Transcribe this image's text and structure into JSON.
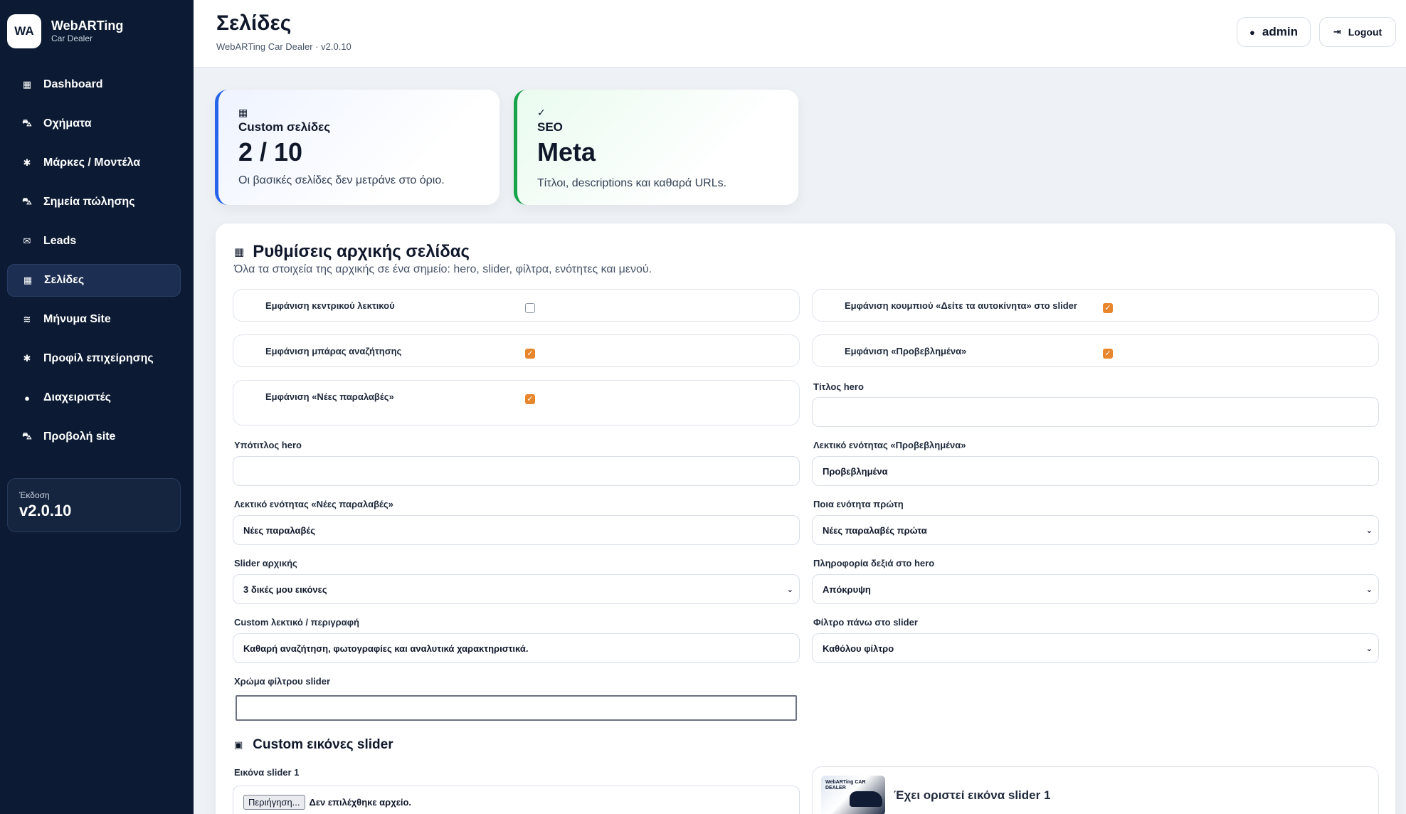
{
  "brand": {
    "logo": "WA",
    "name": "WebARTing",
    "sub": "Car Dealer"
  },
  "sidebar": {
    "items": [
      {
        "label": "Dashboard",
        "icon": "grid-icon"
      },
      {
        "label": "Οχήματα",
        "icon": "car-icon"
      },
      {
        "label": "Μάρκες / Μοντέλα",
        "icon": "gear-icon"
      },
      {
        "label": "Σημεία πώλησης",
        "icon": "car-icon"
      },
      {
        "label": "Leads",
        "icon": "mail-icon"
      },
      {
        "label": "Σελίδες",
        "icon": "grid-icon",
        "active": true
      },
      {
        "label": "Μήνυμα Site",
        "icon": "layers-icon"
      },
      {
        "label": "Προφίλ επιχείρησης",
        "icon": "gear-icon"
      },
      {
        "label": "Διαχειριστές",
        "icon": "user-icon"
      },
      {
        "label": "Προβολή site",
        "icon": "car-icon"
      }
    ],
    "version_label": "Έκδοση",
    "version_value": "v2.0.10"
  },
  "header": {
    "title": "Σελίδες",
    "subtitle": "WebARTing Car Dealer · v2.0.10",
    "user_label": "admin",
    "logout_label": "Logout"
  },
  "stats": {
    "custom": {
      "label": "Custom σελίδες",
      "value": "2 / 10",
      "desc": "Οι βασικές σελίδες δεν μετράνε στο όριο."
    },
    "seo": {
      "label": "SEO",
      "value": "Meta",
      "desc": "Τίτλοι, descriptions και καθαρά URLs."
    }
  },
  "panel": {
    "title": "Ρυθμίσεις αρχικής σελίδας",
    "subtitle": "Όλα τα στοιχεία της αρχικής σε ένα σημείο: hero, slider, φίλτρα, ενότητες και μενού.",
    "toggles": {
      "show_center_text": {
        "label": "Εμφάνιση κεντρικού λεκτικού",
        "checked": false
      },
      "show_button": {
        "label": "Εμφάνιση κουμπιού «Δείτε τα αυτοκίνητα» στο slider",
        "checked": true
      },
      "show_search": {
        "label": "Εμφάνιση μπάρας αναζήτησης",
        "checked": true
      },
      "show_featured": {
        "label": "Εμφάνιση «Προβεβλημένα»",
        "checked": true
      },
      "show_new": {
        "label": "Εμφάνιση «Νέες παραλαβές»",
        "checked": true
      }
    },
    "fields": {
      "hero_title": {
        "label": "Τίτλος hero",
        "value": ""
      },
      "hero_subtitle": {
        "label": "Υπότιτλος hero",
        "value": ""
      },
      "featured_text": {
        "label": "Λεκτικό ενότητας «Προβεβλημένα»",
        "value": "Προβεβλημένα"
      },
      "new_text": {
        "label": "Λεκτικό ενότητας «Νέες παραλαβές»",
        "value": "Νέες παραλαβές"
      },
      "first_section": {
        "label": "Ποια ενότητα πρώτη",
        "value": "Νέες παραλαβές πρώτα"
      },
      "slider": {
        "label": "Slider αρχικής",
        "value": "3 δικές μου εικόνες"
      },
      "hero_info": {
        "label": "Πληροφορία δεξιά στο hero",
        "value": "Απόκρυψη"
      },
      "custom_text": {
        "label": "Custom λεκτικό / περιγραφή",
        "value": "Καθαρή αναζήτηση, φωτογραφίες και αναλυτικά χαρακτηριστικά."
      },
      "slider_filter": {
        "label": "Φίλτρο πάνω στο slider",
        "value": "Καθόλου φίλτρο"
      },
      "filter_color": {
        "label": "Χρώμα φίλτρου slider",
        "value": ""
      }
    },
    "slider_images": {
      "title": "Custom εικόνες slider",
      "image1_label": "Εικόνα slider 1",
      "browse_label": "Περιήγηση...",
      "no_file": "Δεν επιλέχθηκε αρχείο.",
      "thumb_text": "WebARTing CAR DEALER",
      "preview_text": "Έχει οριστεί εικόνα slider 1"
    }
  },
  "colors": {
    "sidebar": "#0c1b33",
    "accent_blue": "#2563eb",
    "accent_green": "#16a34a",
    "checkbox": "#e8862d"
  }
}
